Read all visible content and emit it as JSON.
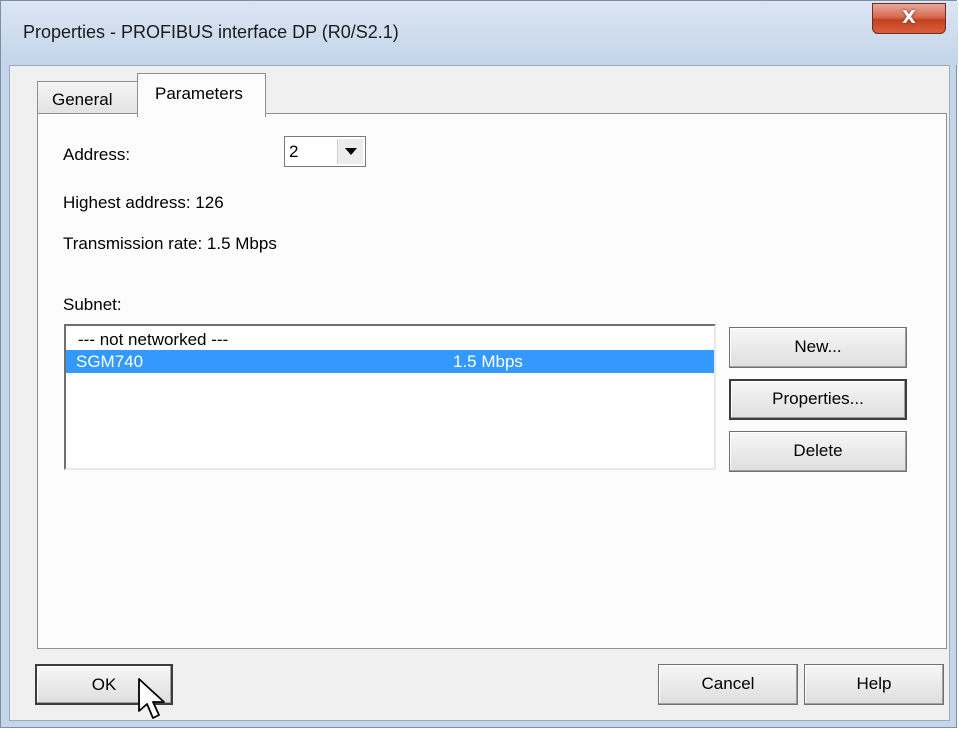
{
  "window": {
    "title": "Properties - PROFIBUS interface  DP (R0/S2.1)",
    "close_glyph": "X"
  },
  "tabs": [
    {
      "label": "General",
      "active": false
    },
    {
      "label": "Parameters",
      "active": true
    }
  ],
  "parameters": {
    "address_label": "Address:",
    "address_value": "2",
    "highest_address": "Highest address:  126",
    "transmission_rate": "Transmission rate: 1.5 Mbps",
    "subnet_label": "Subnet:",
    "subnets": [
      {
        "name": "--- not networked ---",
        "rate": "",
        "selected": false
      },
      {
        "name": "SGM740",
        "rate": "1.5 Mbps",
        "selected": true
      }
    ],
    "buttons": {
      "new": "New...",
      "properties": "Properties...",
      "delete": "Delete"
    }
  },
  "footer": {
    "ok": "OK",
    "cancel": "Cancel",
    "help": "Help"
  },
  "colors": {
    "selection": "#3399ff",
    "close_button": "#c4411f"
  },
  "icons": [
    "close-icon",
    "dropdown-arrow-icon",
    "mouse-cursor-icon"
  ]
}
